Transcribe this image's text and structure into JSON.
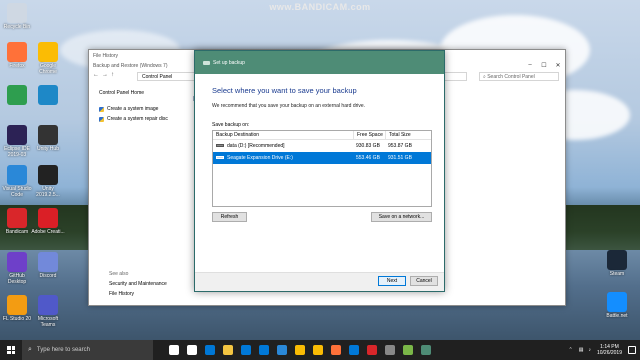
{
  "watermark": "www.BANDICAM.com",
  "desktop_icons": [
    {
      "label": "Recycle Bin",
      "icon": "recycle-bin-icon",
      "color": "#cfd8e3"
    },
    {
      "label": "Firefox",
      "icon": "firefox-icon",
      "color": "#ff7139"
    },
    {
      "label": "Google Chrome",
      "icon": "chrome-icon",
      "color": "#fbbc04"
    },
    {
      "label": "",
      "icon": "app-green-icon",
      "color": "#2e9e4f"
    },
    {
      "label": "",
      "icon": "app-blue-icon",
      "color": "#1e88c7"
    },
    {
      "label": "Eclipse IDE 2019-03",
      "icon": "eclipse-icon",
      "color": "#2c2255"
    },
    {
      "label": "Unity Hub",
      "icon": "unity-hub-icon",
      "color": "#333333"
    },
    {
      "label": "Visual Studio Code",
      "icon": "vscode-icon",
      "color": "#2a88d8"
    },
    {
      "label": "Unity 2019.2.5...",
      "icon": "unity-icon",
      "color": "#222222"
    },
    {
      "label": "Bandicam",
      "icon": "bandicam-icon",
      "color": "#d9262a"
    },
    {
      "label": "Adobe Creati...",
      "icon": "adobe-cc-icon",
      "color": "#da1f26"
    },
    {
      "label": "GitHub Desktop",
      "icon": "github-icon",
      "color": "#6e40c9"
    },
    {
      "label": "Discord",
      "icon": "discord-icon",
      "color": "#7289da"
    },
    {
      "label": "FL Studio 20",
      "icon": "fl-studio-icon",
      "color": "#f39c12"
    },
    {
      "label": "Microsoft Teams",
      "icon": "teams-icon",
      "color": "#5059c9"
    },
    {
      "label": "Steam",
      "icon": "steam-icon",
      "color": "#1b2838"
    },
    {
      "label": "Battle.net",
      "icon": "battlenet-icon",
      "color": "#148eff"
    }
  ],
  "explorer": {
    "title": "File History",
    "subtitle": "Backup and Restore (Windows 7)",
    "address": "Control Panel",
    "search_placeholder": "Search Control Panel",
    "nav": {
      "home": "Control Panel Home",
      "items": [
        "Create a system image",
        "Create a system repair disc"
      ]
    },
    "heading_fragment": "B",
    "see_also_label": "See also",
    "see_also": [
      "Security and Maintenance",
      "File History"
    ]
  },
  "dialog": {
    "title": "Set up backup",
    "heading": "Select where you want to save your backup",
    "subtext": "We recommend that you save your backup on an external hard drive.",
    "save_label": "Save backup on:",
    "columns": [
      "Backup Destination",
      "Free Space",
      "Total Size"
    ],
    "rows": [
      {
        "name": "data (D:) [Recommended]",
        "free": "930.83 GB",
        "total": "953.87 GB",
        "selected": false
      },
      {
        "name": "Seagate Expansion Drive (E:)",
        "free": "553.46 GB",
        "total": "931.51 GB",
        "selected": true
      }
    ],
    "refresh": "Refresh",
    "save_network": "Save on a network...",
    "next": "Next",
    "cancel": "Cancel"
  },
  "taskbar": {
    "search_placeholder": "Type here to search",
    "apps": [
      {
        "icon": "cortana-icon",
        "color": "#ffffff"
      },
      {
        "icon": "task-view-icon",
        "color": "#ffffff"
      },
      {
        "icon": "edge-icon",
        "color": "#0078d7"
      },
      {
        "icon": "file-explorer-icon",
        "color": "#f4c542"
      },
      {
        "icon": "store-icon",
        "color": "#0078d7"
      },
      {
        "icon": "mail-icon",
        "color": "#0078d7"
      },
      {
        "icon": "vscode-icon",
        "color": "#2a88d8"
      },
      {
        "icon": "chrome-icon",
        "color": "#fbbc04"
      },
      {
        "icon": "chrome-icon",
        "color": "#fbbc04"
      },
      {
        "icon": "firefox-icon",
        "color": "#ff7139"
      },
      {
        "icon": "edge-icon",
        "color": "#0078d7"
      },
      {
        "icon": "bandicam-icon",
        "color": "#d9262a"
      },
      {
        "icon": "unity-icon",
        "color": "#888888"
      },
      {
        "icon": "control-panel-icon",
        "color": "#7ab648"
      },
      {
        "icon": "file-history-icon",
        "color": "#4e8c76"
      }
    ],
    "time": "1:14 PM",
    "date": "10/26/2019"
  }
}
